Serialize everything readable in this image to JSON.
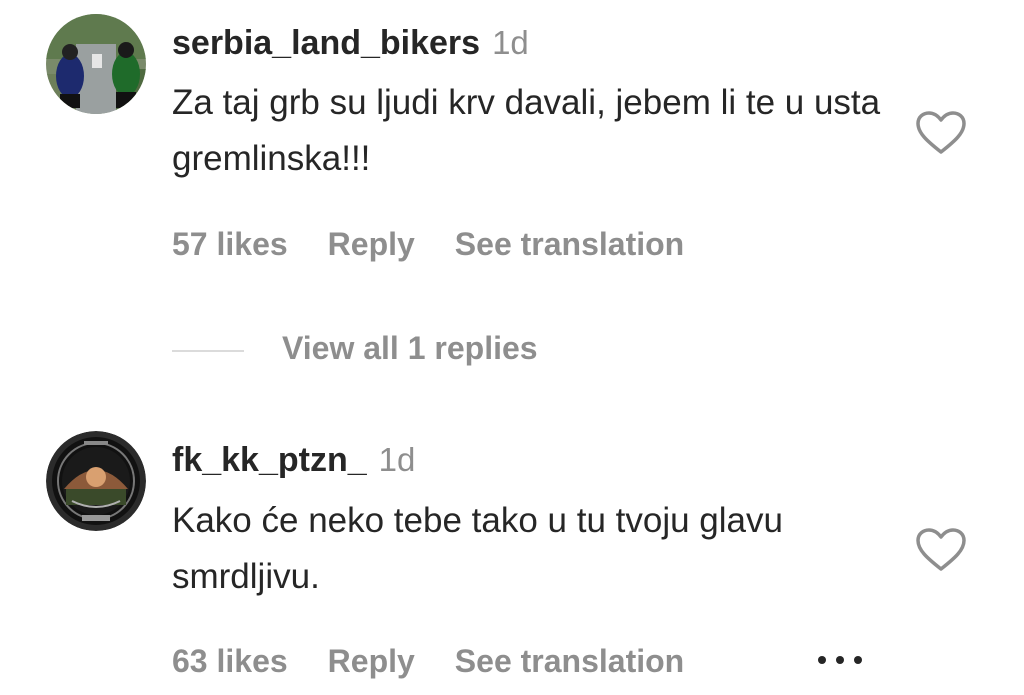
{
  "comments": [
    {
      "username": "serbia_land_bikers",
      "time": "1d",
      "text": "Za taj grb su ljudi krv davali, jebem li te u usta gremlinska!!!",
      "likes": "57 likes",
      "reply_label": "Reply",
      "translate_label": "See translation",
      "avatar_icon": "motorcycle-riders-photo",
      "like_icon": "heart-outline-icon"
    },
    {
      "username": "fk_kk_ptzn_",
      "time": "1d",
      "text": "Kako će neko tebe tako u tu tvoju glavu smrdljivu.",
      "likes": "63 likes",
      "reply_label": "Reply",
      "translate_label": "See translation",
      "avatar_icon": "club-crest-logo",
      "like_icon": "heart-outline-icon",
      "more_icon": "ellipsis-icon"
    }
  ],
  "replies": {
    "label": "View all 1 replies"
  },
  "colors": {
    "primary_text": "#262626",
    "secondary_text": "#8e8e8e",
    "divider": "#dbdbdb"
  }
}
